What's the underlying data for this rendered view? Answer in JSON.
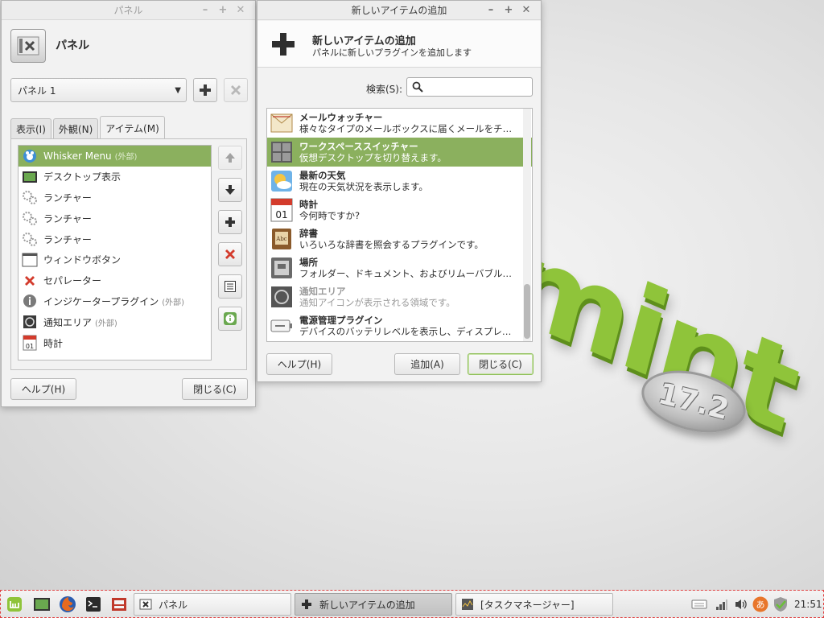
{
  "wallpaper": {
    "logo_text": "mint",
    "version_badge": "17.2"
  },
  "panel_window": {
    "title": "パネル",
    "header_title": "パネル",
    "panel_select": "パネル 1",
    "tabs": [
      "表示(I)",
      "外観(N)",
      "アイテム(M)"
    ],
    "active_tab": "アイテム(M)",
    "items": [
      {
        "label": "Whisker Menu",
        "ext": "(外部)",
        "icon": "whisker-menu-icon"
      },
      {
        "label": "デスクトップ表示",
        "ext": "",
        "icon": "desktop-icon"
      },
      {
        "label": "ランチャー",
        "ext": "",
        "icon": "launcher-icon"
      },
      {
        "label": "ランチャー",
        "ext": "",
        "icon": "launcher-icon"
      },
      {
        "label": "ランチャー",
        "ext": "",
        "icon": "launcher-icon"
      },
      {
        "label": "ウィンドウボタン",
        "ext": "",
        "icon": "window-buttons-icon"
      },
      {
        "label": "セパレーター",
        "ext": "",
        "icon": "separator-icon"
      },
      {
        "label": "インジケータープラグイン",
        "ext": "(外部)",
        "icon": "indicator-icon"
      },
      {
        "label": "通知エリア",
        "ext": "(外部)",
        "icon": "notification-area-icon"
      },
      {
        "label": "時計",
        "ext": "",
        "icon": "clock-icon"
      }
    ],
    "help_label": "ヘルプ(H)",
    "close_label": "閉じる(C)"
  },
  "add_window": {
    "title": "新しいアイテムの追加",
    "header_title": "新しいアイテムの追加",
    "header_subtitle": "パネルに新しいプラグインを追加します",
    "search_label": "検索(S):",
    "search_value": "",
    "plugins": [
      {
        "name": "メールウォッチャー",
        "desc": "様々なタイプのメールボックスに届くメールをチェック…",
        "icon": "mail-watcher-icon"
      },
      {
        "name": "ワークスペーススイッチャー",
        "desc": "仮想デスクトップを切り替えます。",
        "icon": "workspace-switcher-icon"
      },
      {
        "name": "最新の天気",
        "desc": "現在の天気状況を表示します。",
        "icon": "weather-icon"
      },
      {
        "name": "時計",
        "desc": "今何時ですか?",
        "icon": "clock-icon",
        "calendar_day": "01"
      },
      {
        "name": "辞書",
        "desc": "いろいろな辞書を照会するプラグインです。",
        "icon": "dictionary-icon",
        "book_label": "Abc"
      },
      {
        "name": "場所",
        "desc": "フォルダー、ドキュメント、およびリムーバブルメディア…",
        "icon": "places-icon"
      },
      {
        "name": "通知エリア",
        "desc": "通知アイコンが表示される領域です。",
        "icon": "notification-area-icon"
      },
      {
        "name": "電源管理プラグイン",
        "desc": "デバイスのバッテリレベルを表示し、ディスプレイの…",
        "icon": "power-manager-icon"
      }
    ],
    "help_label": "ヘルプ(H)",
    "add_label": "追加(A)",
    "close_label": "閉じる(C)"
  },
  "taskbar": {
    "launchers": [
      "mint-menu-icon",
      "show-desktop-icon",
      "firefox-icon",
      "terminal-icon",
      "file-manager-icon"
    ],
    "tasks": [
      {
        "label": "パネル",
        "icon": "panel-settings-icon",
        "active": false
      },
      {
        "label": "新しいアイテムの追加",
        "icon": "add-item-icon",
        "active": true
      },
      {
        "label": "[タスクマネージャー]",
        "icon": "task-manager-icon",
        "active": false
      }
    ],
    "tray": [
      "keyboard-icon",
      "network-signal-icon",
      "volume-icon",
      "input-method-icon",
      "update-manager-icon"
    ],
    "input_method_glyph": "あ",
    "clock": "21:51"
  },
  "colors": {
    "selection": "#8bb05e",
    "mint_green": "#8fc43a",
    "remove_red": "#d33b2c"
  }
}
